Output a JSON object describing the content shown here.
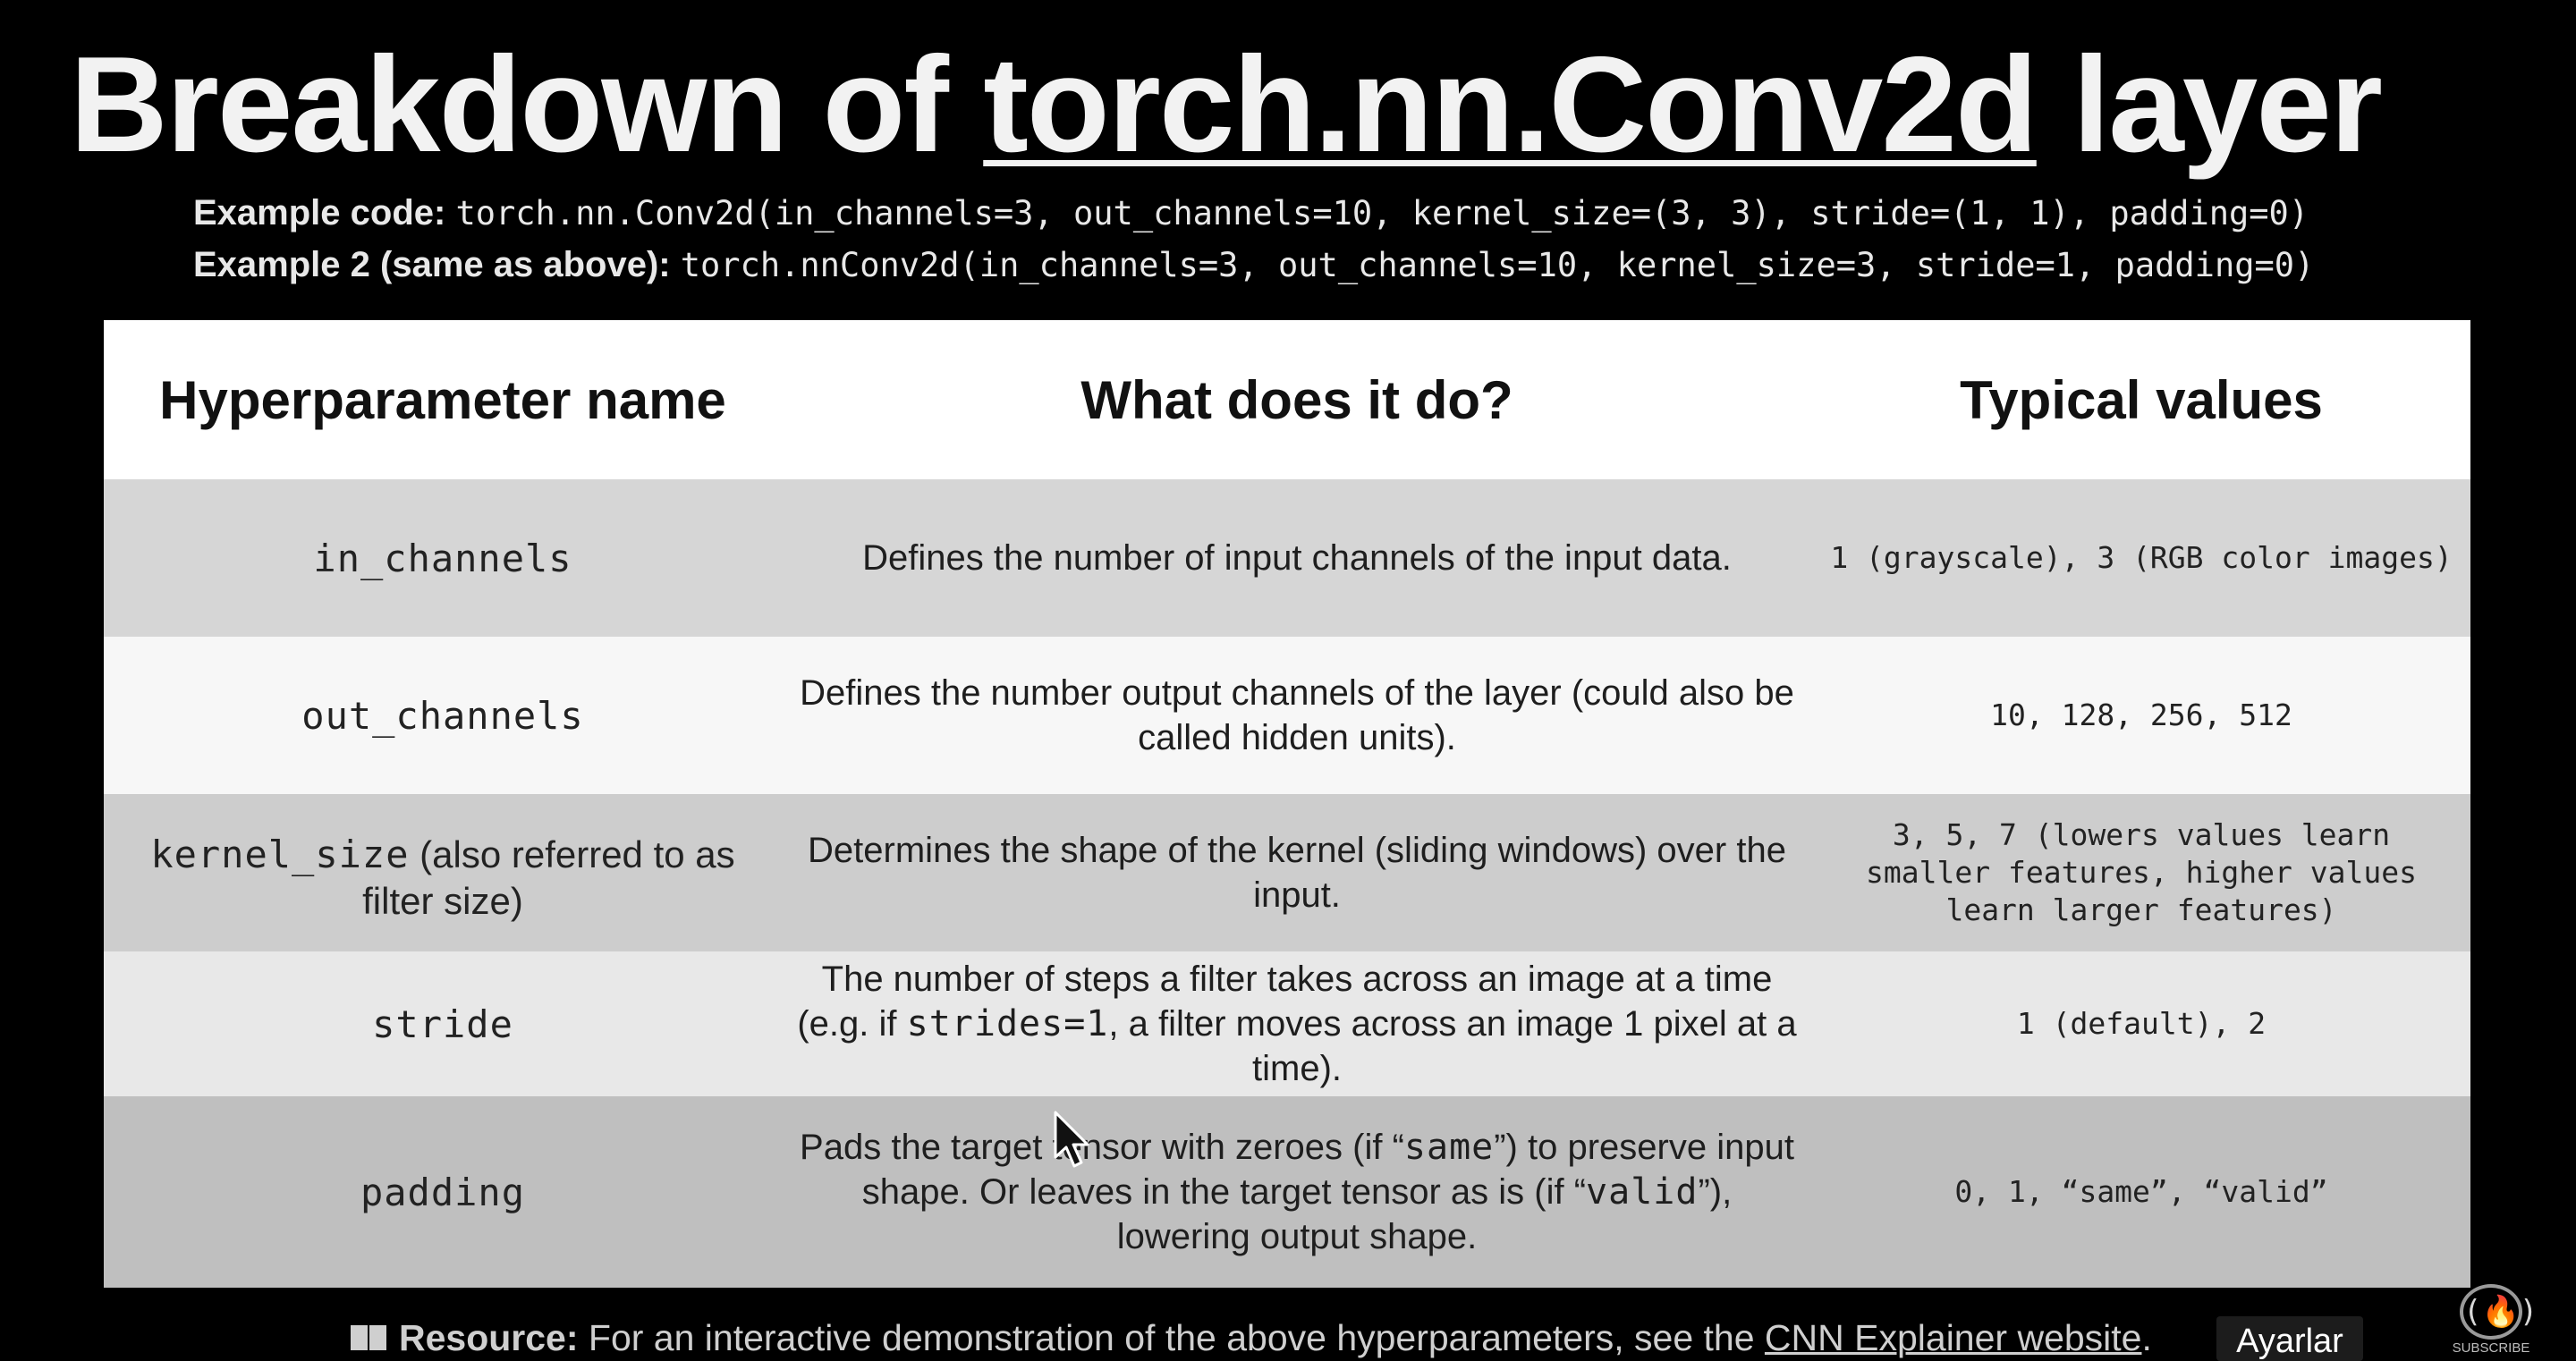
{
  "title": {
    "prefix": "Breakdown of ",
    "code_ref": "torch.nn.Conv2d",
    "suffix": " layer"
  },
  "examples": [
    {
      "label": "Example code:",
      "code": "torch.nn.Conv2d(in_channels=3, out_channels=10, kernel_size=(3, 3), stride=(1, 1), padding=0)"
    },
    {
      "label": "Example 2 (same as above):",
      "code": "torch.nnConv2d(in_channels=3, out_channels=10, kernel_size=3, stride=1, padding=0)"
    }
  ],
  "table": {
    "headers": [
      "Hyperparameter name",
      "What does it do?",
      "Typical values"
    ],
    "rows": [
      {
        "name": "in_channels",
        "description": "Defines the number of input channels of the input data.",
        "typical": "1 (grayscale), 3 (RGB color images)"
      },
      {
        "name": "out_channels",
        "description": "Defines the number output channels of the layer (could also be called hidden units).",
        "typical": "10, 128, 256, 512"
      },
      {
        "name": "kernel_size",
        "name_note": " (also referred to as filter size)",
        "description": "Determines the shape of the kernel (sliding windows) over the input.",
        "typical": "3, 5, 7 (lowers values learn smaller features, higher values learn larger features)"
      },
      {
        "name": "stride",
        "description_parts": [
          "The number of steps a filter takes across an image at a time (e.g. if ",
          "strides=1",
          ", a filter moves across an image 1 pixel at a time)."
        ],
        "typical": "1 (default), 2"
      },
      {
        "name": "padding",
        "description_parts": [
          "Pads the target tensor with zeroes (if “",
          "same",
          "”) to preserve input shape. Or leaves in the target tensor as is (if “",
          "valid",
          "”), lowering output shape."
        ],
        "typical": "0, 1, “same”, “valid”"
      }
    ]
  },
  "resource": {
    "icon": "book-icon",
    "label": "Resource:",
    "text": " For an interactive demonstration of the above hyperparameters, see the ",
    "link": "CNN Explainer website",
    "tail": "."
  },
  "player": {
    "settings_tooltip": "Ayarlar",
    "channel_logo_text": "SUBSCRIBE",
    "channel_logo_icon": "flame-brackets-icon"
  }
}
